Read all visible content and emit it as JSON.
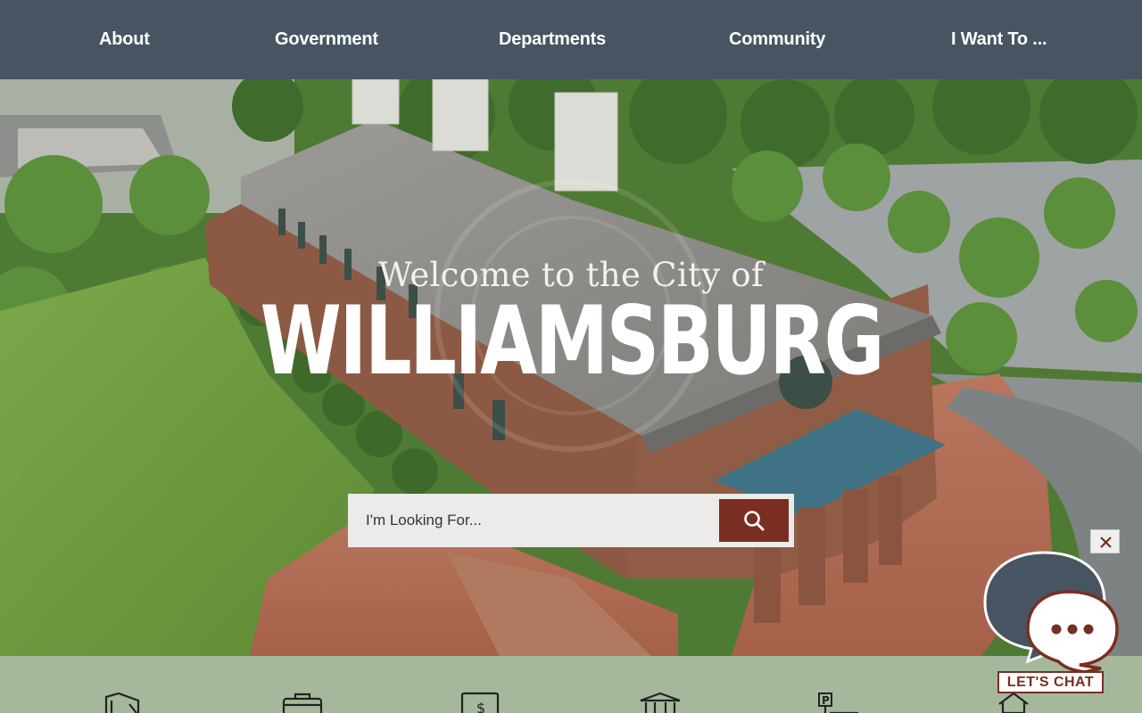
{
  "nav": {
    "items": [
      {
        "label": "About"
      },
      {
        "label": "Government"
      },
      {
        "label": "Departments"
      },
      {
        "label": "Community"
      },
      {
        "label": "I Want To ..."
      }
    ]
  },
  "hero": {
    "welcome": "Welcome to the City of",
    "city": "WILLIAMSBURG"
  },
  "search": {
    "placeholder": "I'm Looking For...",
    "icon": "search-icon"
  },
  "quick_links": {
    "icons": [
      "construction-icon",
      "briefcase-icon",
      "bill-payment-icon",
      "government-building-icon",
      "parking-icon",
      "home-icon"
    ]
  },
  "chat": {
    "label": "LET'S CHAT",
    "close_icon": "close-icon"
  },
  "colors": {
    "nav_bg": "#475563",
    "accent": "#7a2d21",
    "strip_bg": "#a5b89c"
  }
}
